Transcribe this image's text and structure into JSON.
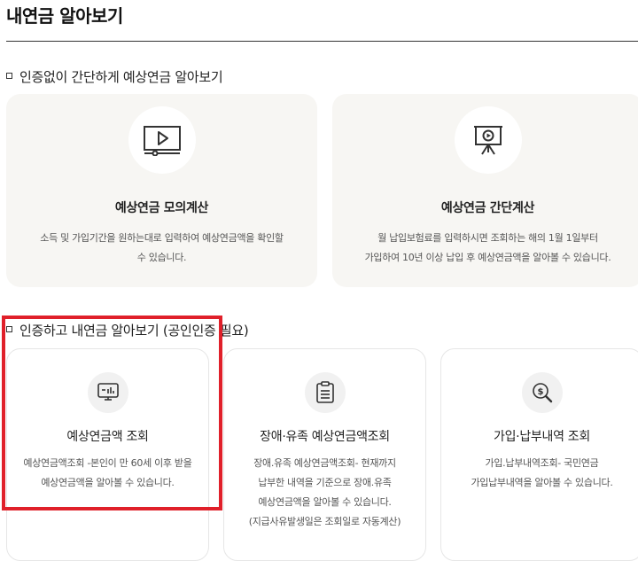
{
  "page": {
    "title": "내연금 알아보기"
  },
  "section1": {
    "heading": "인증없이 간단하게 예상연금 알아보기",
    "cards": [
      {
        "title": "예상연금 모의계산",
        "desc": [
          "소득 및 가입기간을 원하는대로 입력하여 예상연금액을 확인할",
          "수 있습니다."
        ],
        "icon": "video-play-icon"
      },
      {
        "title": "예상연금 간단계산",
        "desc": [
          "월 납입보험료를 입력하시면 조회하는 해의 1월 1일부터",
          "가입하여 10년 이상 납입 후 예상연금액을 알아볼 수 있습니다."
        ],
        "icon": "presentation-play-icon"
      }
    ]
  },
  "section2": {
    "heading": "인증하고 내연금 알아보기 (공인인증 필요)",
    "cards": [
      {
        "title": "예상연금액 조회",
        "desc": [
          "예상연금액조회 -본인이 만 60세 이후 받을",
          "예상연금액을 알아볼 수 있습니다."
        ],
        "icon": "chart-monitor-icon"
      },
      {
        "title": "장애·유족 예상연금액조회",
        "desc": [
          "장애.유족 예상연금액조회- 현재까지",
          "납부한 내역을 기준으로 장애.유족",
          "예상연금액을 알아볼 수 있습니다.",
          "(지급사유발생일은 조회일로 자동계산)"
        ],
        "icon": "clipboard-icon"
      },
      {
        "title": "가입·납부내역 조회",
        "desc": [
          "가입.납부내역조회- 국민연금",
          "가입납부내역을 알아볼 수 있습니다."
        ],
        "icon": "money-search-icon"
      }
    ]
  },
  "colors": {
    "highlight": "#e0202a",
    "card_fill": "#f7f6f3",
    "card_border": "#e6e6e6"
  }
}
